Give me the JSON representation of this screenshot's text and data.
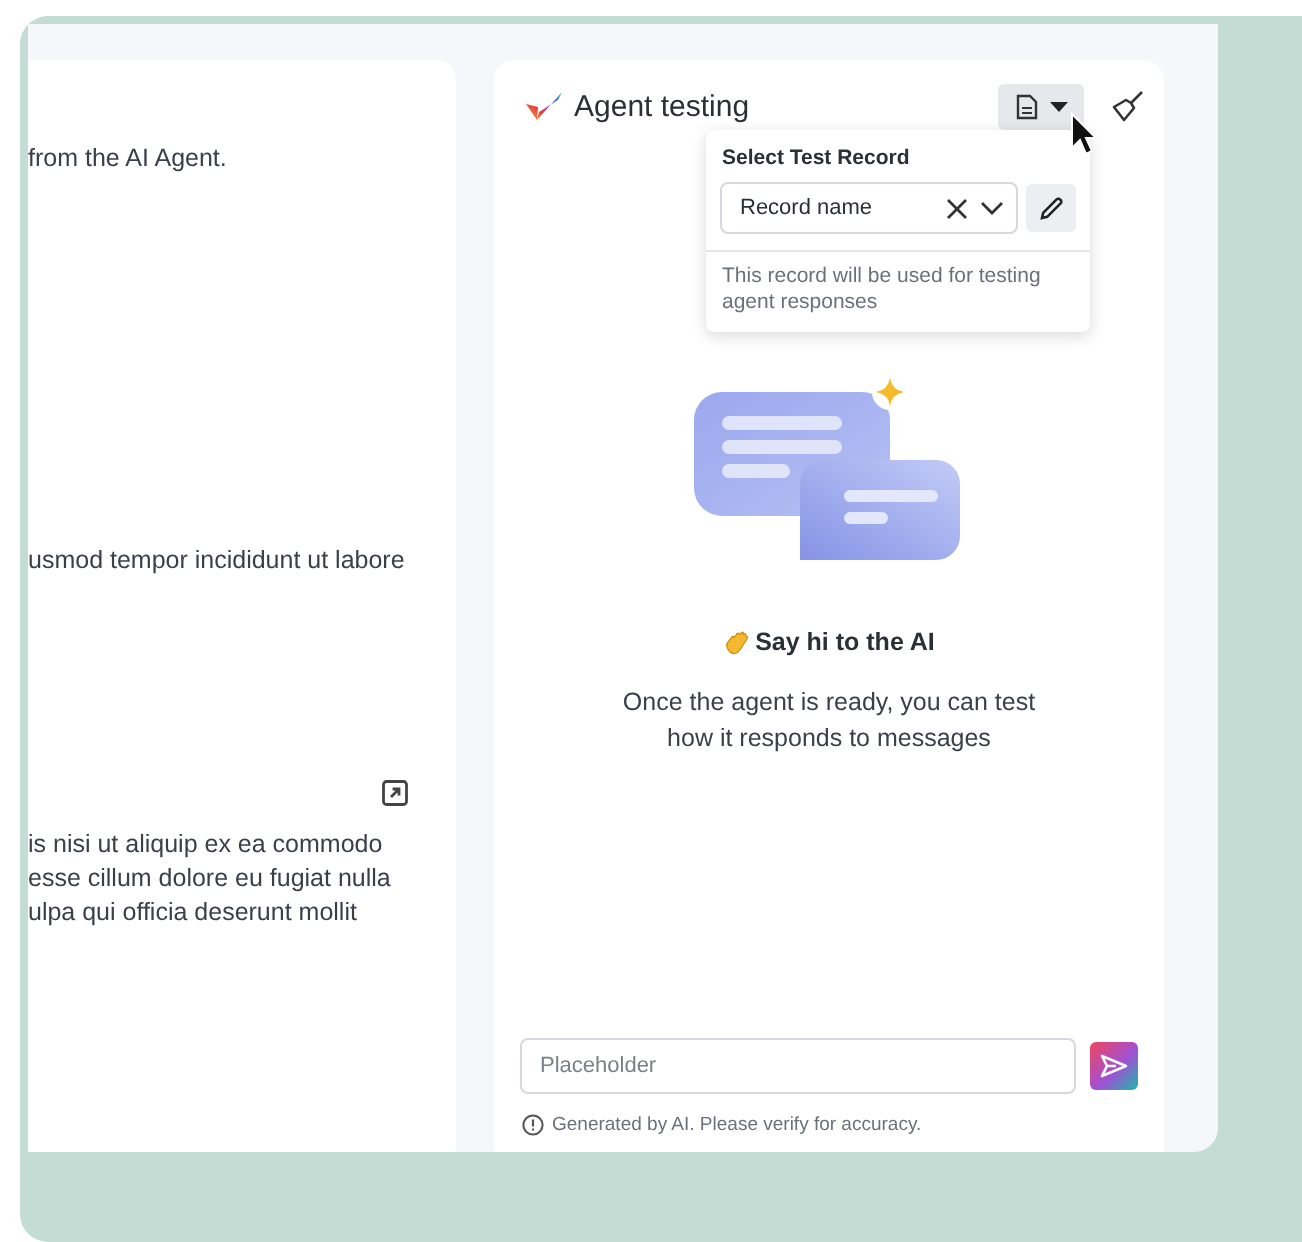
{
  "left_card": {
    "lines_top": [
      "from the AI Agent.",
      "usmod tempor incididunt ut labore"
    ],
    "paragraph_lines": [
      "is nisi ut aliquip ex ea commodo",
      "esse cillum dolore eu fugiat nulla",
      "ulpa qui officia deserunt mollit"
    ]
  },
  "agent_panel": {
    "title": "Agent testing",
    "record_menu": {
      "title": "Select Test Record",
      "value": "Record name",
      "hint": "This record will be used for testing agent responses"
    },
    "greeting": "Say hi to the AI",
    "description": "Once the agent is ready, you can test how it responds to messages",
    "message_field": {
      "placeholder": "Placeholder"
    },
    "disclaimer": "Generated by AI. Please verify for accuracy."
  }
}
